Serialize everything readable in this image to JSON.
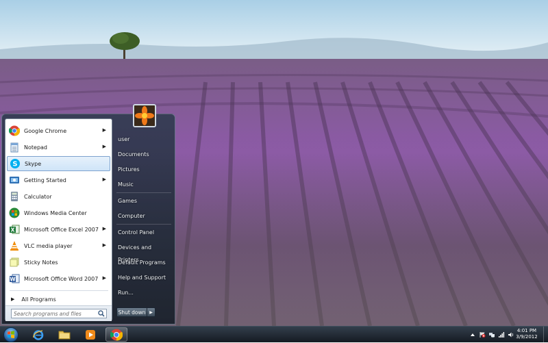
{
  "start_menu": {
    "pinned_programs": [
      {
        "label": "Google Chrome",
        "icon": "chrome-icon",
        "has_submenu": true
      },
      {
        "label": "Notepad",
        "icon": "notepad-icon",
        "has_submenu": true
      },
      {
        "label": "Skype",
        "icon": "skype-icon",
        "has_submenu": false,
        "selected": true
      },
      {
        "label": "Getting Started",
        "icon": "getting-started-icon",
        "has_submenu": true
      },
      {
        "label": "Calculator",
        "icon": "calculator-icon",
        "has_submenu": false
      },
      {
        "label": "Windows Media Center",
        "icon": "media-center-icon",
        "has_submenu": false
      },
      {
        "label": "Microsoft Office Excel 2007",
        "icon": "excel-icon",
        "has_submenu": true
      },
      {
        "label": "VLC media player",
        "icon": "vlc-icon",
        "has_submenu": true
      },
      {
        "label": "Sticky Notes",
        "icon": "sticky-notes-icon",
        "has_submenu": false
      },
      {
        "label": "Microsoft Office Word 2007",
        "icon": "word-icon",
        "has_submenu": true
      }
    ],
    "all_programs_label": "All Programs",
    "search_placeholder": "Search programs and files",
    "right_links": {
      "user": "user",
      "documents": "Documents",
      "pictures": "Pictures",
      "music": "Music",
      "games": "Games",
      "computer": "Computer",
      "control_panel": "Control Panel",
      "devices_printers": "Devices and Printers",
      "default_programs": "Default Programs",
      "help_support": "Help and Support",
      "run": "Run..."
    },
    "shutdown_label": "Shut down"
  },
  "taskbar": {
    "pinned": [
      {
        "name": "internet-explorer-icon"
      },
      {
        "name": "windows-explorer-icon"
      },
      {
        "name": "media-player-icon"
      },
      {
        "name": "chrome-icon",
        "active": true
      }
    ],
    "clock": {
      "time": "4:01 PM",
      "date": "3/9/2012"
    }
  },
  "colors": {
    "selection_border": "#7da2ce",
    "taskbar": "#18202a",
    "lavender": "#8a5aa8"
  }
}
